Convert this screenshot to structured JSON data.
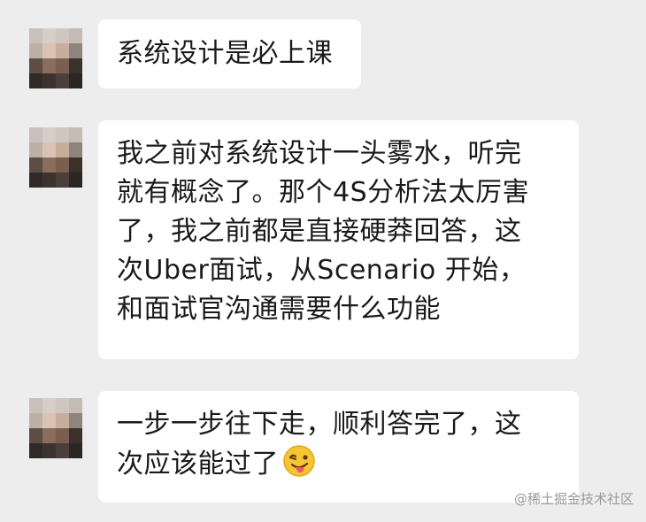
{
  "messages": [
    {
      "lines": [
        "系统设计是必上课"
      ]
    },
    {
      "lines": [
        "我之前对系统设计一头雾水，听完",
        "就有概念了。那个4S分析法太厉害",
        "了，我之前都是直接硬莽回答，这",
        "次Uber面试，从Scenario 开始，",
        "和面试官沟通需要什么功能"
      ]
    },
    {
      "lines": [
        "一步一步往下走，顺利答完了，这",
        "次应该能过了"
      ],
      "emoji": "winking-tongue-emoji"
    }
  ],
  "watermark": "@稀土掘金技术社区",
  "colors": {
    "background": "#ededed",
    "bubble": "#ffffff",
    "text": "#1a1a1a"
  }
}
